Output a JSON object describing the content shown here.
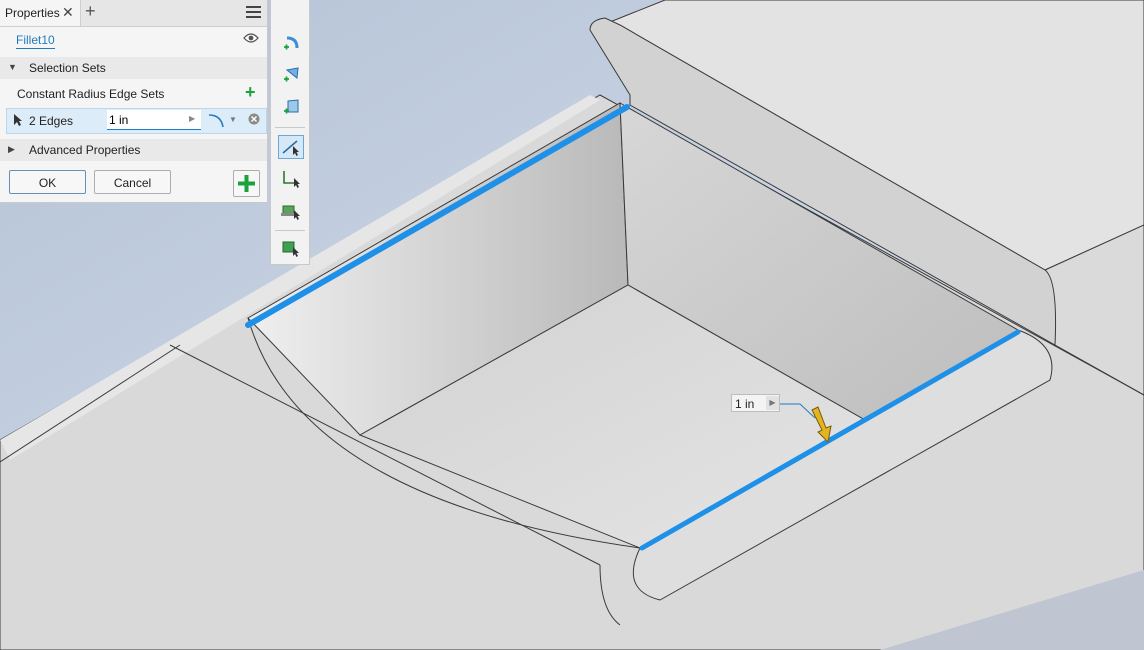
{
  "panel": {
    "tab_title": "Properties",
    "feature_name": "Fillet10",
    "selection_sets_label": "Selection Sets",
    "edge_sets_label": "Constant Radius Edge Sets",
    "edge_row": {
      "edges_label": "2 Edges",
      "radius_value": "1 in"
    },
    "advanced_label": "Advanced Properties",
    "ok_label": "OK",
    "cancel_label": "Cancel"
  },
  "viewport": {
    "dimension_value": "1 in"
  },
  "colors": {
    "highlight_edge": "#1e90e8",
    "accent_green": "#1aa33a",
    "link_blue": "#1f7bbf",
    "arrow_gold": "#e2b323"
  },
  "icons": {
    "tab_close": "close-icon",
    "tab_add": "plus-icon",
    "menu": "hamburger-menu-icon",
    "visibility": "eye-icon",
    "select": "cursor-arrow-icon",
    "remove": "remove-circle-icon",
    "apply_add": "plus-icon"
  }
}
